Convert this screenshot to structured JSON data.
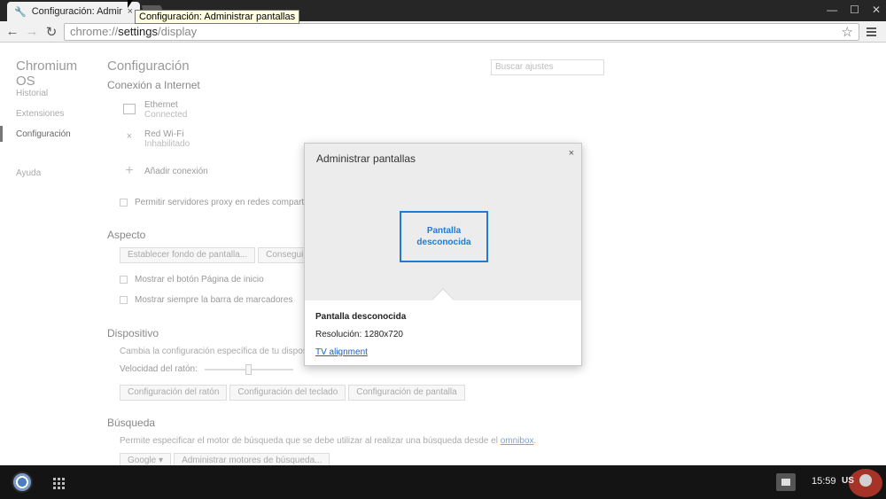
{
  "browser": {
    "tab_title": "Configuración: Administrar pantallas",
    "tooltip": "Configuración: Administrar pantallas",
    "url_scheme": "chrome://",
    "url_host": "settings",
    "url_path": "/display"
  },
  "sidebar": {
    "brand": "Chromium OS",
    "items": [
      {
        "label": "Historial"
      },
      {
        "label": "Extensiones"
      },
      {
        "label": "Configuración"
      },
      {
        "label": "Ayuda"
      }
    ]
  },
  "settings": {
    "title": "Configuración",
    "search_placeholder": "Buscar ajustes",
    "internet": {
      "heading": "Conexión a Internet",
      "ethernet_name": "Ethernet",
      "ethernet_status": "Connected",
      "wifi_name": "Red Wi-Fi",
      "wifi_status": "Inhabilitado",
      "add_connection": "Añadir conexión",
      "proxy_label": "Permitir servidores proxy en redes compart"
    },
    "appearance": {
      "heading": "Aspecto",
      "wallpaper_button": "Establecer fondo de pantalla...",
      "themes_button": "Conseguir t",
      "home_button_label": "Mostrar el botón Página de inicio",
      "bookmarks_bar_label": "Mostrar siempre la barra de marcadores"
    },
    "device": {
      "heading": "Dispositivo",
      "description": "Cambia la configuración específica de tu dispos",
      "mouse_speed_label": "Velocidad del ratón:",
      "mouse_button": "Configuración del ratón",
      "keyboard_button": "Configuración del teclado",
      "display_button": "Configuración de pantalla"
    },
    "search": {
      "heading": "Búsqueda",
      "description": "Permite especificar el motor de búsqueda que se debe utilizar al realizar una búsqueda desde el",
      "omnibox_link": "omnibox",
      "description_end": ".",
      "engine_select": "Google",
      "manage_engines_button": "Administrar motores de búsqueda..."
    }
  },
  "dialog": {
    "title": "Administrar pantallas",
    "close": "×",
    "display_box_label": "Pantalla desconocida",
    "display_name": "Pantalla desconocida",
    "resolution": "Resolución: 1280x720",
    "tv_alignment_link": "TV alignment"
  },
  "shelf": {
    "clock": "15:59",
    "ime": "US"
  },
  "colors": {
    "accent": "#1f7bd6",
    "link": "#1a5ec9",
    "shelf": "#141414"
  }
}
